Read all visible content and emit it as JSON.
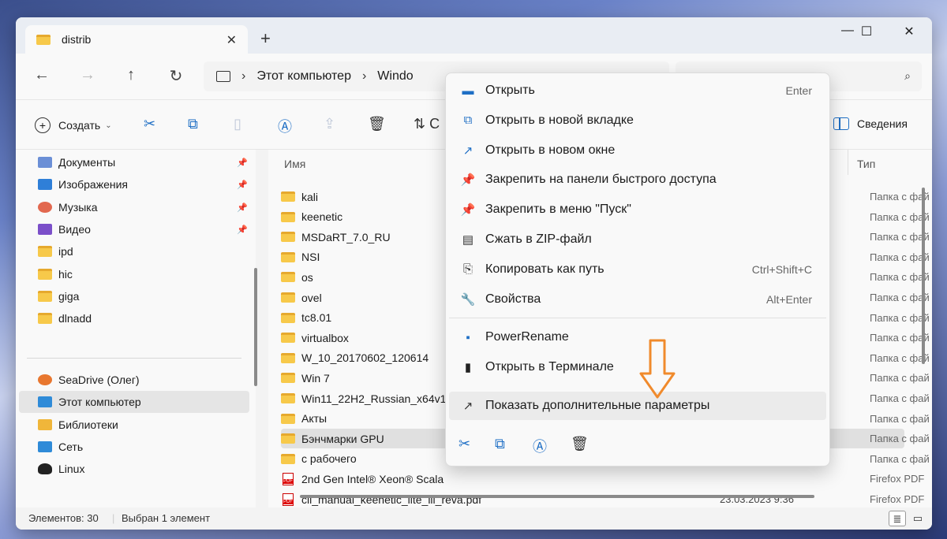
{
  "window": {
    "tab_title": "distrib",
    "controls": {
      "minimize": "—",
      "maximize": "☐",
      "close": "✕"
    }
  },
  "nav": {
    "back": "←",
    "forward": "→",
    "up": "↑",
    "refresh": "↻",
    "breadcrumb": [
      "Этот компьютер",
      "Windo"
    ]
  },
  "commandbar": {
    "create_label": "Создать",
    "details_label": "Сведения",
    "sort_partial": "С"
  },
  "sidebar": {
    "pinned": [
      {
        "label": "Документы",
        "icon": "documents-icon",
        "color": "#6b8fd6"
      },
      {
        "label": "Изображения",
        "icon": "pictures-icon",
        "color": "#2f7fd8"
      },
      {
        "label": "Музыка",
        "icon": "music-icon",
        "color": "#e2684f"
      },
      {
        "label": "Видео",
        "icon": "video-icon",
        "color": "#7b4fc9"
      }
    ],
    "folders": [
      "ipd",
      "hic",
      "giga",
      "dlnadd"
    ],
    "locations": [
      {
        "label": "SeaDrive (Олег)",
        "icon": "seadrive-icon",
        "color": "#e8772f"
      },
      {
        "label": "Этот компьютер",
        "icon": "computer-icon",
        "color": "#2f8bd8"
      },
      {
        "label": "Библиотеки",
        "icon": "libraries-icon",
        "color": "#f0b63a"
      },
      {
        "label": "Сеть",
        "icon": "network-icon",
        "color": "#2f8bd8"
      },
      {
        "label": "Linux",
        "icon": "linux-icon",
        "color": "#222222"
      }
    ]
  },
  "content": {
    "columns": {
      "name": "Имя",
      "type": "Тип"
    },
    "rows": [
      {
        "name": "kali",
        "kind": "folder",
        "type": "Папка с фай"
      },
      {
        "name": "keenetic",
        "kind": "folder",
        "type": "Папка с фай"
      },
      {
        "name": "MSDaRT_7.0_RU",
        "kind": "folder",
        "type": "Папка с фай"
      },
      {
        "name": "NSI",
        "kind": "folder",
        "type": "Папка с фай"
      },
      {
        "name": "os",
        "kind": "folder",
        "type": "Папка с фай"
      },
      {
        "name": "ovel",
        "kind": "folder",
        "type": "Папка с фай"
      },
      {
        "name": "tc8.01",
        "kind": "folder",
        "type": "Папка с фай"
      },
      {
        "name": "virtualbox",
        "kind": "folder",
        "type": "Папка с фай"
      },
      {
        "name": "W_10_20170602_120614",
        "kind": "folder",
        "type": "Папка с фай"
      },
      {
        "name": "Win 7",
        "kind": "folder",
        "type": "Папка с фай"
      },
      {
        "name": "Win11_22H2_Russian_x64v1",
        "kind": "folder",
        "type": "Папка с фай"
      },
      {
        "name": "Акты",
        "kind": "folder",
        "type": "Папка с фай"
      },
      {
        "name": "Бэнчмарки GPU",
        "kind": "folder",
        "type": "Папка с фай",
        "selected": true
      },
      {
        "name": "с рабочего",
        "kind": "folder",
        "type": "Папка с фай"
      },
      {
        "name": "2nd Gen Intel® Xeon® Scala",
        "kind": "pdf",
        "type": "Firefox PDF"
      },
      {
        "name": "cli_manual_keenetic_lite_iii_reva.pdf",
        "kind": "pdf",
        "type": "Firefox PDF",
        "date": "23.03.2023 9:36"
      }
    ]
  },
  "status": {
    "items": "Элементов: 30",
    "selected": "Выбран 1 элемент"
  },
  "context_menu": {
    "items": [
      {
        "label": "Открыть",
        "shortcut": "Enter",
        "icon": "folder-open-icon",
        "glyph": "▬"
      },
      {
        "label": "Открыть в новой вкладке",
        "shortcut": "",
        "icon": "new-tab-icon",
        "glyph": "⧉"
      },
      {
        "label": "Открыть в новом окне",
        "shortcut": "",
        "icon": "new-window-icon",
        "glyph": "↗"
      },
      {
        "label": "Закрепить на панели быстрого доступа",
        "shortcut": "",
        "icon": "pin-icon",
        "glyph": "📌"
      },
      {
        "label": "Закрепить в меню \"Пуск\"",
        "shortcut": "",
        "icon": "pin-start-icon",
        "glyph": "📌"
      },
      {
        "label": "Сжать в ZIP-файл",
        "shortcut": "",
        "icon": "zip-icon",
        "glyph": "▤"
      },
      {
        "label": "Копировать как путь",
        "shortcut": "Ctrl+Shift+C",
        "icon": "copy-path-icon",
        "glyph": "⎘"
      },
      {
        "label": "Свойства",
        "shortcut": "Alt+Enter",
        "icon": "properties-icon",
        "glyph": "🔧"
      }
    ],
    "extra": [
      {
        "label": "PowerRename",
        "icon": "powerrename-icon",
        "glyph": "▪"
      },
      {
        "label": "Открыть в Терминале",
        "icon": "terminal-icon",
        "glyph": "▮"
      }
    ],
    "more": {
      "label": "Показать дополнительные параметры",
      "icon": "more-options-icon",
      "glyph": "↗"
    },
    "annotation_color": "#f08a2c"
  }
}
